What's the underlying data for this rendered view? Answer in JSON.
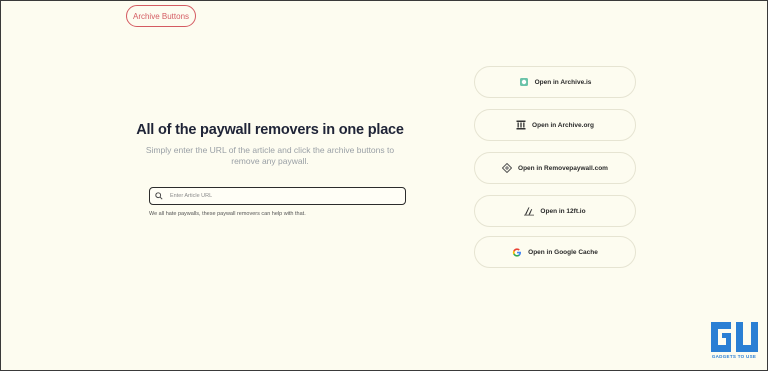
{
  "header": {
    "pill_label": "Archive Buttons"
  },
  "hero": {
    "title": "All of the paywall removers in one place",
    "subtitle": "Simply enter the URL of the article and click the archive buttons to remove any paywall."
  },
  "search": {
    "placeholder": "Enter Article URL",
    "value": ""
  },
  "hint": "We all hate paywalls, these paywall removers can help with that.",
  "buttons": [
    {
      "label": "Open in Archive.is",
      "icon": "archive-is-icon"
    },
    {
      "label": "Open in Archive.org",
      "icon": "archive-org-icon"
    },
    {
      "label": "Open in Removepaywall.com",
      "icon": "removepaywall-icon"
    },
    {
      "label": "Open in 12ft.io",
      "icon": "ladder-icon"
    },
    {
      "label": "Open in Google Cache",
      "icon": "google-icon"
    }
  ],
  "watermark": {
    "brand": "GADGETS TO USE",
    "mark": "GU"
  },
  "colors": {
    "background": "#fdfcf0",
    "accent": "#d45b62",
    "watermark": "#2a7fd4"
  }
}
